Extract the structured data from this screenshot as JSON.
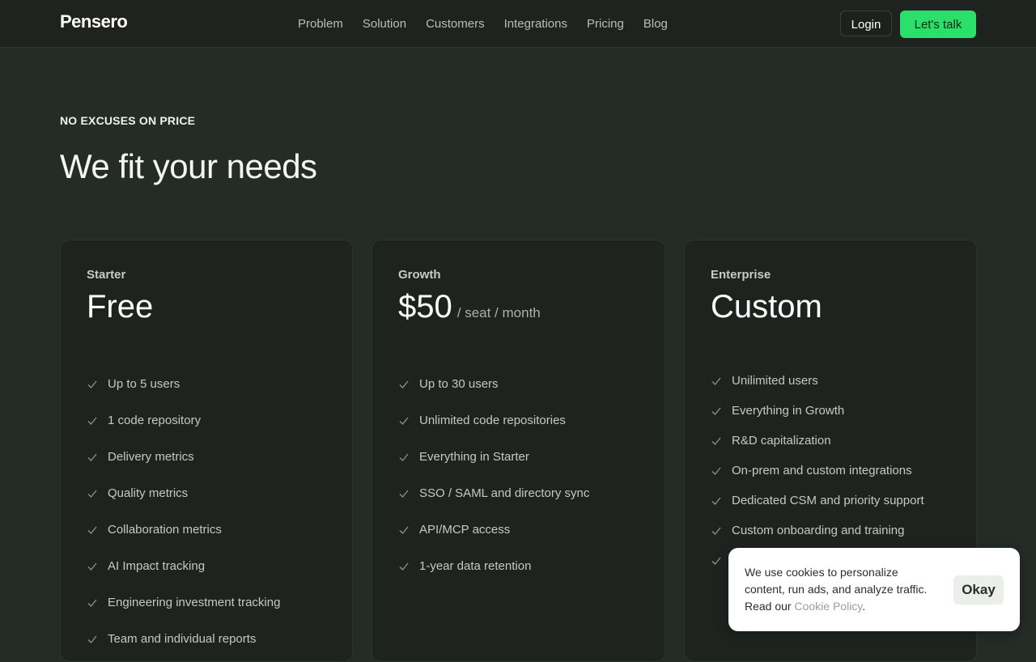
{
  "brand": {
    "logo": "Pensero"
  },
  "nav": {
    "items": [
      "Problem",
      "Solution",
      "Customers",
      "Integrations",
      "Pricing",
      "Blog"
    ],
    "login_label": "Login",
    "cta_label": "Let's talk"
  },
  "hero": {
    "eyebrow": "NO EXCUSES ON PRICE",
    "title": "We fit your needs"
  },
  "plans": [
    {
      "name": "Starter",
      "price": "Free",
      "unit": "",
      "features": [
        "Up to 5 users",
        "1 code repository",
        "Delivery metrics",
        "Quality metrics",
        "Collaboration metrics",
        "AI Impact tracking",
        "Engineering investment tracking",
        "Team and individual reports"
      ]
    },
    {
      "name": "Growth",
      "price": "$50",
      "unit": "/ seat / month",
      "features": [
        "Up to 30 users",
        "Unlimited code repositories",
        "Everything in Starter",
        "SSO / SAML and directory sync",
        "API/MCP access",
        "1-year data retention"
      ]
    },
    {
      "name": "Enterprise",
      "price": "Custom",
      "unit": "",
      "features": [
        "Unilimited users",
        "Everything in Growth",
        "R&D capitalization",
        "On-prem and custom integrations",
        "Dedicated CSM and priority support",
        "Custom onboarding and training",
        ""
      ]
    }
  ],
  "cookie": {
    "text": "We use cookies to personalize content, run ads, and analyze traffic. Read our ",
    "link_label": "Cookie Policy",
    "suffix": ".",
    "button_label": "Okay"
  },
  "icons": {
    "feature_check": "check-icon"
  },
  "colors": {
    "accent": "#2be06a",
    "background": "#252b26",
    "card": "#1e2320"
  }
}
